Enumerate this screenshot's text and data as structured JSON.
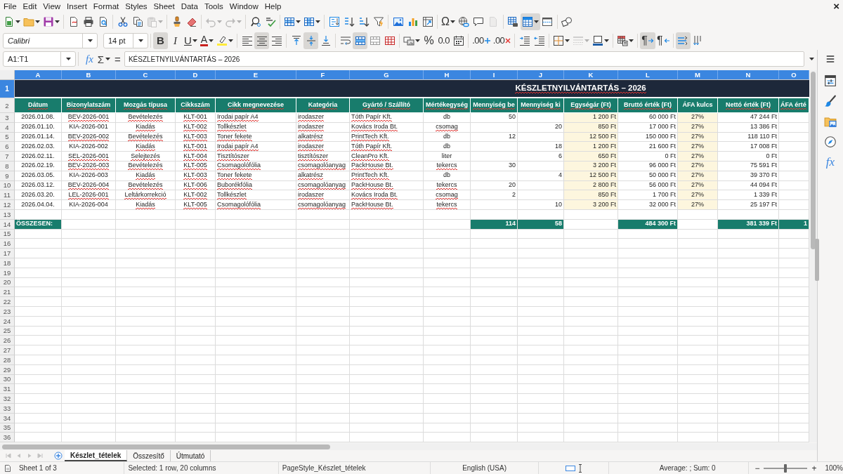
{
  "menu_bar": {
    "items": [
      "File",
      "Edit",
      "View",
      "Insert",
      "Format",
      "Styles",
      "Sheet",
      "Data",
      "Tools",
      "Window",
      "Help"
    ],
    "close_glyph": "×"
  },
  "standard_toolbar": {
    "groups": [
      {
        "buttons": [
          {
            "kind": "new-document",
            "dropdown": true,
            "pressed": false,
            "disabled": false
          },
          {
            "kind": "open",
            "dropdown": true,
            "pressed": false,
            "disabled": false
          },
          {
            "kind": "save",
            "dropdown": true,
            "pressed": false,
            "disabled": false
          }
        ]
      },
      {
        "buttons": [
          {
            "kind": "export-pdf",
            "dropdown": false,
            "pressed": false,
            "disabled": false
          },
          {
            "kind": "print",
            "dropdown": false,
            "pressed": false,
            "disabled": false
          },
          {
            "kind": "print-preview",
            "dropdown": false,
            "pressed": false,
            "disabled": false
          }
        ]
      },
      {
        "buttons": [
          {
            "kind": "cut",
            "dropdown": false,
            "pressed": false,
            "disabled": false
          },
          {
            "kind": "copy",
            "dropdown": false,
            "pressed": false,
            "disabled": false
          },
          {
            "kind": "paste",
            "dropdown": true,
            "pressed": false,
            "disabled": true
          }
        ]
      },
      {
        "buttons": [
          {
            "kind": "clone-formatting",
            "dropdown": false,
            "pressed": false,
            "disabled": false
          },
          {
            "kind": "clear-formatting",
            "dropdown": false,
            "pressed": false,
            "disabled": false
          }
        ]
      },
      {
        "buttons": [
          {
            "kind": "undo",
            "dropdown": true,
            "pressed": false,
            "disabled": true
          },
          {
            "kind": "redo",
            "dropdown": true,
            "pressed": false,
            "disabled": true
          }
        ]
      },
      {
        "buttons": [
          {
            "kind": "find-replace",
            "dropdown": false,
            "pressed": false,
            "disabled": false
          },
          {
            "kind": "spelling",
            "dropdown": false,
            "pressed": false,
            "disabled": false
          }
        ]
      },
      {
        "buttons": [
          {
            "kind": "insert-rows",
            "dropdown": true,
            "pressed": false,
            "disabled": false
          },
          {
            "kind": "insert-columns",
            "dropdown": true,
            "pressed": false,
            "disabled": false
          }
        ]
      },
      {
        "buttons": [
          {
            "kind": "sort",
            "dropdown": false,
            "pressed": false,
            "disabled": false
          },
          {
            "kind": "sort-ascending",
            "dropdown": false,
            "pressed": false,
            "disabled": false
          },
          {
            "kind": "sort-descending",
            "dropdown": false,
            "pressed": false,
            "disabled": false
          },
          {
            "kind": "autofilter",
            "dropdown": false,
            "pressed": false,
            "disabled": false
          }
        ]
      },
      {
        "buttons": [
          {
            "kind": "insert-image",
            "dropdown": false,
            "pressed": false,
            "disabled": false
          },
          {
            "kind": "insert-chart",
            "dropdown": false,
            "pressed": false,
            "disabled": false
          },
          {
            "kind": "pivot-table",
            "dropdown": false,
            "pressed": false,
            "disabled": false
          }
        ]
      },
      {
        "buttons": [
          {
            "kind": "special-character",
            "label": "Ω",
            "dropdown": true,
            "pressed": false,
            "disabled": false
          },
          {
            "kind": "hyperlink",
            "dropdown": false,
            "pressed": false,
            "disabled": false
          },
          {
            "kind": "comment",
            "dropdown": false,
            "pressed": false,
            "disabled": false
          },
          {
            "kind": "header-footer",
            "dropdown": false,
            "pressed": false,
            "disabled": true
          }
        ]
      },
      {
        "buttons": [
          {
            "kind": "print-area",
            "dropdown": false,
            "pressed": false,
            "disabled": false
          },
          {
            "kind": "freeze-rows",
            "dropdown": true,
            "pressed": true,
            "disabled": false
          },
          {
            "kind": "split-window",
            "dropdown": false,
            "pressed": false,
            "disabled": false
          }
        ]
      },
      {
        "buttons": [
          {
            "kind": "draw-functions",
            "dropdown": false,
            "pressed": false,
            "disabled": false
          }
        ]
      }
    ]
  },
  "formatting_toolbar": {
    "font_name": "Calibri",
    "font_size": "14 pt",
    "groups": [
      {
        "buttons": [
          {
            "kind": "bold",
            "label": "B",
            "dropdown": false,
            "pressed": true,
            "disabled": false
          },
          {
            "kind": "italic",
            "label": "I",
            "dropdown": false,
            "pressed": false,
            "disabled": false
          },
          {
            "kind": "underline",
            "label": "U",
            "dropdown": true,
            "pressed": false,
            "disabled": false
          },
          {
            "kind": "font-color",
            "label": "A",
            "dropdown": true,
            "pressed": false,
            "disabled": false
          },
          {
            "kind": "highlight",
            "dropdown": true,
            "pressed": false,
            "disabled": false
          }
        ]
      },
      {
        "buttons": [
          {
            "kind": "align-left",
            "dropdown": false,
            "pressed": false,
            "disabled": false
          },
          {
            "kind": "align-center",
            "dropdown": false,
            "pressed": true,
            "disabled": false
          },
          {
            "kind": "align-right",
            "dropdown": false,
            "pressed": false,
            "disabled": false
          }
        ]
      },
      {
        "buttons": [
          {
            "kind": "align-top",
            "dropdown": false,
            "pressed": false,
            "disabled": false
          },
          {
            "kind": "align-middle",
            "dropdown": false,
            "pressed": true,
            "disabled": false
          },
          {
            "kind": "align-bottom",
            "dropdown": false,
            "pressed": false,
            "disabled": false
          }
        ]
      },
      {
        "buttons": [
          {
            "kind": "wrap-text",
            "dropdown": false,
            "pressed": false,
            "disabled": false
          },
          {
            "kind": "merge-center",
            "dropdown": false,
            "pressed": true,
            "disabled": false
          },
          {
            "kind": "merge-cells",
            "dropdown": false,
            "pressed": false,
            "disabled": false
          },
          {
            "kind": "unmerge-cells",
            "dropdown": false,
            "pressed": false,
            "disabled": false
          }
        ]
      },
      {
        "buttons": [
          {
            "kind": "number-format",
            "dropdown": true,
            "pressed": false,
            "disabled": false
          },
          {
            "kind": "percent",
            "label": "%",
            "dropdown": false,
            "pressed": false,
            "disabled": false
          },
          {
            "kind": "standard-format",
            "label": "0.0",
            "dropdown": false,
            "pressed": false,
            "disabled": false
          },
          {
            "kind": "date-format",
            "dropdown": false,
            "pressed": false,
            "disabled": false
          }
        ]
      },
      {
        "buttons": [
          {
            "kind": "add-decimal",
            "label": ".00",
            "dropdown": false,
            "pressed": false,
            "disabled": false
          },
          {
            "kind": "delete-decimal",
            "label": ".00",
            "dropdown": false,
            "pressed": false,
            "disabled": false
          }
        ]
      },
      {
        "buttons": [
          {
            "kind": "increase-indent",
            "dropdown": false,
            "pressed": false,
            "disabled": false
          },
          {
            "kind": "decrease-indent",
            "dropdown": false,
            "pressed": false,
            "disabled": false
          }
        ]
      },
      {
        "buttons": [
          {
            "kind": "borders",
            "dropdown": true,
            "pressed": false,
            "disabled": false
          },
          {
            "kind": "border-style",
            "dropdown": true,
            "pressed": false,
            "disabled": true
          },
          {
            "kind": "border-color",
            "dropdown": true,
            "pressed": false,
            "disabled": false
          }
        ]
      },
      {
        "buttons": [
          {
            "kind": "conditional-format",
            "dropdown": true,
            "pressed": false,
            "disabled": false
          }
        ]
      },
      {
        "buttons": [
          {
            "kind": "left-to-right",
            "label": "¶",
            "dropdown": false,
            "pressed": true,
            "disabled": false
          },
          {
            "kind": "right-to-left",
            "label": "¶",
            "dropdown": false,
            "pressed": false,
            "disabled": false
          }
        ]
      },
      {
        "buttons": [
          {
            "kind": "text-horizontal",
            "dropdown": false,
            "pressed": true,
            "disabled": false
          },
          {
            "kind": "text-vertical",
            "dropdown": false,
            "pressed": false,
            "disabled": false
          }
        ]
      }
    ]
  },
  "formula_bar": {
    "name_box": "A1:T1",
    "function_wizard": "fx",
    "sum": "Σ",
    "equals": "=",
    "content": "KÉSZLETNYILVÁNTARTÁS – 2026"
  },
  "grid": {
    "columns": [
      {
        "letter": "A",
        "selected": true
      },
      {
        "letter": "B",
        "selected": true
      },
      {
        "letter": "C",
        "selected": true
      },
      {
        "letter": "D",
        "selected": true
      },
      {
        "letter": "E",
        "selected": true
      },
      {
        "letter": "F",
        "selected": true
      },
      {
        "letter": "G",
        "selected": true
      },
      {
        "letter": "H",
        "selected": true
      },
      {
        "letter": "I",
        "selected": true
      },
      {
        "letter": "J",
        "selected": true
      },
      {
        "letter": "K",
        "selected": true
      },
      {
        "letter": "L",
        "selected": true
      },
      {
        "letter": "M",
        "selected": true
      },
      {
        "letter": "N",
        "selected": true
      },
      {
        "letter": "O",
        "selected": true
      }
    ],
    "rows": [
      {
        "number": "1",
        "selected": true,
        "kind": "title",
        "cells": [
          {
            "text": "KÉSZLETNYILVÁNTARTÁS – 2026",
            "spell_error": true
          }
        ]
      },
      {
        "number": "2",
        "selected": false,
        "kind": "header",
        "cells": [
          {
            "text": "Dátum",
            "spell_error": true
          },
          {
            "text": "Bizonylatszám",
            "spell_error": true
          },
          {
            "text": "Mozgás típusa",
            "spell_error": true
          },
          {
            "text": "Cikkszám",
            "spell_error": true
          },
          {
            "text": "Cikk megnevezése",
            "spell_error": true
          },
          {
            "text": "Kategória",
            "spell_error": true
          },
          {
            "text": "Gyártó / Szállító",
            "spell_error": true
          },
          {
            "text": "Mértékegység",
            "spell_error": true
          },
          {
            "text": "Mennyiség be",
            "spell_error": true
          },
          {
            "text": "Mennyiség ki",
            "spell_error": true
          },
          {
            "text": "Egységár (Ft)",
            "spell_error": true
          },
          {
            "text": "Bruttó érték (Ft)",
            "spell_error": true
          },
          {
            "text": "ÁFA kulcs",
            "spell_error": false
          },
          {
            "text": "Nettó érték (Ft)",
            "spell_error": true
          },
          {
            "text": "ÁFA érté",
            "spell_error": true
          }
        ]
      },
      {
        "number": "3",
        "selected": false,
        "kind": "data",
        "cells": [
          {
            "text": "2026.01.08.",
            "spell_error": false
          },
          {
            "text": "BEV-2026-001",
            "spell_error": true
          },
          {
            "text": "Bevételezés",
            "spell_error": true
          },
          {
            "text": "KLT-001",
            "spell_error": true
          },
          {
            "text": "Irodai papír A4",
            "spell_error": true
          },
          {
            "text": "irodaszer",
            "spell_error": true
          },
          {
            "text": "Tóth Papír Kft.",
            "spell_error": true
          },
          {
            "text": "db",
            "spell_error": false
          },
          {
            "text": "50",
            "spell_error": false
          },
          null,
          {
            "text": "1 200 Ft",
            "spell_error": false
          },
          {
            "text": "60 000 Ft",
            "spell_error": false
          },
          {
            "text": "27%",
            "spell_error": false
          },
          {
            "text": "47 244 Ft",
            "spell_error": false
          },
          null
        ]
      },
      {
        "number": "4",
        "selected": false,
        "kind": "data",
        "cells": [
          {
            "text": "2026.01.10.",
            "spell_error": false
          },
          {
            "text": "KIA-2026-001",
            "spell_error": false
          },
          {
            "text": "Kiadás",
            "spell_error": true
          },
          {
            "text": "KLT-002",
            "spell_error": true
          },
          {
            "text": "Tollkészlet",
            "spell_error": true
          },
          {
            "text": "irodaszer",
            "spell_error": true
          },
          {
            "text": "Kovács Iroda Bt.",
            "spell_error": true
          },
          {
            "text": "csomag",
            "spell_error": true
          },
          null,
          {
            "text": "20",
            "spell_error": false
          },
          {
            "text": "850 Ft",
            "spell_error": false
          },
          {
            "text": "17 000 Ft",
            "spell_error": false
          },
          {
            "text": "27%",
            "spell_error": false
          },
          {
            "text": "13 386 Ft",
            "spell_error": false
          },
          null
        ]
      },
      {
        "number": "5",
        "selected": false,
        "kind": "data",
        "cells": [
          {
            "text": "2026.01.14.",
            "spell_error": false
          },
          {
            "text": "BEV-2026-002",
            "spell_error": true
          },
          {
            "text": "Bevételezés",
            "spell_error": true
          },
          {
            "text": "KLT-003",
            "spell_error": true
          },
          {
            "text": "Toner fekete",
            "spell_error": true
          },
          {
            "text": "alkatrész",
            "spell_error": true
          },
          {
            "text": "PrintTech Kft.",
            "spell_error": true
          },
          {
            "text": "db",
            "spell_error": false
          },
          {
            "text": "12",
            "spell_error": false
          },
          null,
          {
            "text": "12 500 Ft",
            "spell_error": false
          },
          {
            "text": "150 000 Ft",
            "spell_error": false
          },
          {
            "text": "27%",
            "spell_error": false
          },
          {
            "text": "118 110 Ft",
            "spell_error": false
          },
          null
        ]
      },
      {
        "number": "6",
        "selected": false,
        "kind": "data",
        "cells": [
          {
            "text": "2026.02.03.",
            "spell_error": false
          },
          {
            "text": "KIA-2026-002",
            "spell_error": false
          },
          {
            "text": "Kiadás",
            "spell_error": true
          },
          {
            "text": "KLT-001",
            "spell_error": true
          },
          {
            "text": "Irodai papír A4",
            "spell_error": true
          },
          {
            "text": "irodaszer",
            "spell_error": true
          },
          {
            "text": "Tóth Papír Kft.",
            "spell_error": true
          },
          {
            "text": "db",
            "spell_error": false
          },
          null,
          {
            "text": "18",
            "spell_error": false
          },
          {
            "text": "1 200 Ft",
            "spell_error": false
          },
          {
            "text": "21 600 Ft",
            "spell_error": false
          },
          {
            "text": "27%",
            "spell_error": false
          },
          {
            "text": "17 008 Ft",
            "spell_error": false
          },
          null
        ]
      },
      {
        "number": "7",
        "selected": false,
        "kind": "data",
        "cells": [
          {
            "text": "2026.02.11.",
            "spell_error": false
          },
          {
            "text": "SEL-2026-001",
            "spell_error": true
          },
          {
            "text": "Selejtezés",
            "spell_error": true
          },
          {
            "text": "KLT-004",
            "spell_error": true
          },
          {
            "text": "Tisztítószer",
            "spell_error": true
          },
          {
            "text": "tisztítószer",
            "spell_error": true
          },
          {
            "text": "CleanPro Kft.",
            "spell_error": true
          },
          {
            "text": "liter",
            "spell_error": false
          },
          null,
          {
            "text": "6",
            "spell_error": false
          },
          {
            "text": "650 Ft",
            "spell_error": false
          },
          {
            "text": "0 Ft",
            "spell_error": false
          },
          {
            "text": "27%",
            "spell_error": false
          },
          {
            "text": "0 Ft",
            "spell_error": false
          },
          null
        ]
      },
      {
        "number": "8",
        "selected": false,
        "kind": "data",
        "cells": [
          {
            "text": "2026.02.19.",
            "spell_error": false
          },
          {
            "text": "BEV-2026-003",
            "spell_error": true
          },
          {
            "text": "Bevételezés",
            "spell_error": true
          },
          {
            "text": "KLT-005",
            "spell_error": true
          },
          {
            "text": "Csomagolófólia",
            "spell_error": true
          },
          {
            "text": "csomagolóanyag",
            "spell_error": true
          },
          {
            "text": "PackHouse Bt.",
            "spell_error": true
          },
          {
            "text": "tekercs",
            "spell_error": true
          },
          {
            "text": "30",
            "spell_error": false
          },
          null,
          {
            "text": "3 200 Ft",
            "spell_error": false
          },
          {
            "text": "96 000 Ft",
            "spell_error": false
          },
          {
            "text": "27%",
            "spell_error": false
          },
          {
            "text": "75 591 Ft",
            "spell_error": false
          },
          null
        ]
      },
      {
        "number": "9",
        "selected": false,
        "kind": "data",
        "cells": [
          {
            "text": "2026.03.05.",
            "spell_error": false
          },
          {
            "text": "KIA-2026-003",
            "spell_error": false
          },
          {
            "text": "Kiadás",
            "spell_error": true
          },
          {
            "text": "KLT-003",
            "spell_error": true
          },
          {
            "text": "Toner fekete",
            "spell_error": true
          },
          {
            "text": "alkatrész",
            "spell_error": true
          },
          {
            "text": "PrintTech Kft.",
            "spell_error": true
          },
          {
            "text": "db",
            "spell_error": false
          },
          null,
          {
            "text": "4",
            "spell_error": false
          },
          {
            "text": "12 500 Ft",
            "spell_error": false
          },
          {
            "text": "50 000 Ft",
            "spell_error": false
          },
          {
            "text": "27%",
            "spell_error": false
          },
          {
            "text": "39 370 Ft",
            "spell_error": false
          },
          null
        ]
      },
      {
        "number": "10",
        "selected": false,
        "kind": "data",
        "cells": [
          {
            "text": "2026.03.12.",
            "spell_error": false
          },
          {
            "text": "BEV-2026-004",
            "spell_error": true
          },
          {
            "text": "Bevételezés",
            "spell_error": true
          },
          {
            "text": "KLT-006",
            "spell_error": true
          },
          {
            "text": "Buborékfólia",
            "spell_error": true
          },
          {
            "text": "csomagolóanyag",
            "spell_error": true
          },
          {
            "text": "PackHouse Bt.",
            "spell_error": true
          },
          {
            "text": "tekercs",
            "spell_error": true
          },
          {
            "text": "20",
            "spell_error": false
          },
          null,
          {
            "text": "2 800 Ft",
            "spell_error": false
          },
          {
            "text": "56 000 Ft",
            "spell_error": false
          },
          {
            "text": "27%",
            "spell_error": false
          },
          {
            "text": "44 094 Ft",
            "spell_error": false
          },
          null
        ]
      },
      {
        "number": "11",
        "selected": false,
        "kind": "data",
        "cells": [
          {
            "text": "2026.03.20.",
            "spell_error": false
          },
          {
            "text": "LEL-2026-001",
            "spell_error": true
          },
          {
            "text": "Leltárkorrekció",
            "spell_error": true
          },
          {
            "text": "KLT-002",
            "spell_error": true
          },
          {
            "text": "Tollkészlet",
            "spell_error": true
          },
          {
            "text": "irodaszer",
            "spell_error": true
          },
          {
            "text": "Kovács Iroda Bt.",
            "spell_error": true
          },
          {
            "text": "csomag",
            "spell_error": true
          },
          {
            "text": "2",
            "spell_error": false
          },
          null,
          {
            "text": "850 Ft",
            "spell_error": false
          },
          {
            "text": "1 700 Ft",
            "spell_error": false
          },
          {
            "text": "27%",
            "spell_error": false
          },
          {
            "text": "1 339 Ft",
            "spell_error": false
          },
          null
        ]
      },
      {
        "number": "12",
        "selected": false,
        "kind": "data",
        "cells": [
          {
            "text": "2026.04.04.",
            "spell_error": false
          },
          {
            "text": "KIA-2026-004",
            "spell_error": false
          },
          {
            "text": "Kiadás",
            "spell_error": true
          },
          {
            "text": "KLT-005",
            "spell_error": true
          },
          {
            "text": "Csomagolófólia",
            "spell_error": true
          },
          {
            "text": "csomagolóanyag",
            "spell_error": true
          },
          {
            "text": "PackHouse Bt.",
            "spell_error": true
          },
          {
            "text": "tekercs",
            "spell_error": true
          },
          null,
          {
            "text": "10",
            "spell_error": false
          },
          {
            "text": "3 200 Ft",
            "spell_error": false
          },
          {
            "text": "32 000 Ft",
            "spell_error": false
          },
          {
            "text": "27%",
            "spell_error": false
          },
          {
            "text": "25 197 Ft",
            "spell_error": false
          },
          null
        ]
      },
      {
        "number": "13",
        "selected": false,
        "kind": "blank"
      },
      {
        "number": "14",
        "selected": false,
        "kind": "total",
        "cells": [
          {
            "text": "ÖSSZESEN:",
            "spell_error": false
          },
          null,
          null,
          null,
          null,
          null,
          null,
          null,
          {
            "text": "114",
            "spell_error": false
          },
          {
            "text": "58",
            "spell_error": false
          },
          null,
          {
            "text": "484 300 Ft",
            "spell_error": false
          },
          null,
          {
            "text": "381 339 Ft",
            "spell_error": false
          },
          {
            "text": "1",
            "spell_error": false
          }
        ]
      },
      {
        "number": "15",
        "selected": false,
        "kind": "blank"
      },
      {
        "number": "16",
        "selected": false,
        "kind": "blank"
      },
      {
        "number": "17",
        "selected": false,
        "kind": "blank"
      },
      {
        "number": "18",
        "selected": false,
        "kind": "blank"
      },
      {
        "number": "19",
        "selected": false,
        "kind": "blank"
      },
      {
        "number": "20",
        "selected": false,
        "kind": "blank"
      },
      {
        "number": "21",
        "selected": false,
        "kind": "blank"
      },
      {
        "number": "22",
        "selected": false,
        "kind": "blank"
      },
      {
        "number": "23",
        "selected": false,
        "kind": "blank"
      },
      {
        "number": "24",
        "selected": false,
        "kind": "blank"
      },
      {
        "number": "25",
        "selected": false,
        "kind": "blank"
      },
      {
        "number": "26",
        "selected": false,
        "kind": "blank"
      },
      {
        "number": "27",
        "selected": false,
        "kind": "blank"
      },
      {
        "number": "28",
        "selected": false,
        "kind": "blank"
      },
      {
        "number": "29",
        "selected": false,
        "kind": "blank"
      },
      {
        "number": "30",
        "selected": false,
        "kind": "blank"
      },
      {
        "number": "31",
        "selected": false,
        "kind": "blank"
      },
      {
        "number": "32",
        "selected": false,
        "kind": "blank"
      },
      {
        "number": "33",
        "selected": false,
        "kind": "blank"
      },
      {
        "number": "34",
        "selected": false,
        "kind": "blank"
      },
      {
        "number": "35",
        "selected": false,
        "kind": "blank"
      },
      {
        "number": "36",
        "selected": false,
        "kind": "blank"
      }
    ]
  },
  "sidebar": {
    "decks": [
      {
        "kind": "properties"
      },
      {
        "kind": "styles"
      },
      {
        "kind": "gallery"
      },
      {
        "kind": "navigator"
      },
      {
        "kind": "functions",
        "label": "fx"
      }
    ]
  },
  "sheet_navigation": [
    {
      "kind": "first",
      "disabled": true
    },
    {
      "kind": "previous",
      "disabled": true
    },
    {
      "kind": "next",
      "disabled": true
    },
    {
      "kind": "last",
      "disabled": true
    }
  ],
  "sheet_tabs": [
    {
      "label": "Készlet_tételek",
      "selected": true
    },
    {
      "label": "Összesítő",
      "selected": false
    },
    {
      "label": "Útmutató",
      "selected": false
    }
  ],
  "status_bar": {
    "sheet": "Sheet 1 of 3",
    "selection": "Selected: 1 row, 20 columns",
    "page_style": "PageStyle_Készlet_tételek",
    "language": "English (USA)",
    "summary": "Average: ; Sum: 0",
    "zoom": {
      "out": "−",
      "in": "+",
      "level": 0.5,
      "reading": "100%"
    }
  }
}
